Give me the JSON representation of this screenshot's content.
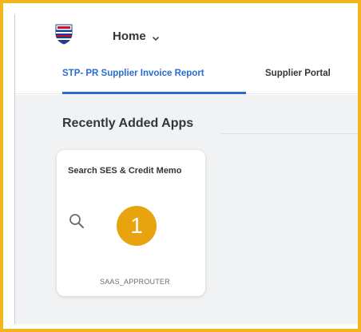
{
  "shell": {
    "home_label": "Home",
    "logo_icon": "union-pacific-shield-icon"
  },
  "tabs": [
    {
      "label": "STP- PR Supplier Invoice Report",
      "active": true
    },
    {
      "label": "Supplier Portal",
      "active": false
    }
  ],
  "section": {
    "title": "Recently Added Apps"
  },
  "tile": {
    "title": "Search SES & Credit Memo",
    "icon": "search-icon",
    "footer": "SAAS_APPROUTER"
  },
  "annotation": {
    "step": "1"
  },
  "colors": {
    "frame": "#F2B51E",
    "active_tab": "#2a6bd1",
    "badge": "#E8A40F",
    "content_bg": "#f1f2f4"
  }
}
